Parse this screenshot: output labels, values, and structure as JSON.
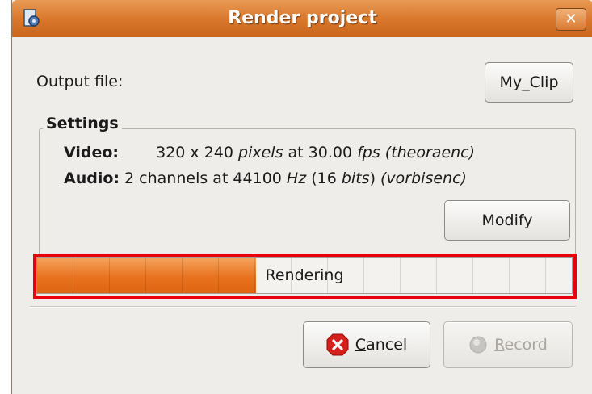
{
  "window": {
    "title": "Render project",
    "close_label": "✕",
    "app_icon": "gear-document-icon"
  },
  "output": {
    "label": "Output file:",
    "file_button_label": "My_Clip"
  },
  "settings": {
    "legend": "Settings",
    "video_label": "Video:",
    "video_value_pre": "320 x 240 ",
    "video_value_unit1": "pixels",
    "video_value_mid": " at 30.00 ",
    "video_value_unit2": "fps (theoraenc)",
    "audio_label": "Audio:",
    "audio_value_pre": "2 channels at 44100 ",
    "audio_value_unit1": "Hz",
    "audio_value_mid": " (16 ",
    "audio_value_unit2": "bits",
    "audio_value_post": ") ",
    "audio_value_codec": "(vorbisenc)",
    "modify_label": "Modify"
  },
  "progress": {
    "text": "Rendering",
    "fraction": 0.41,
    "accent_color": "#e8731f",
    "highlight_color": "#e8000b"
  },
  "buttons": {
    "cancel_prefix": "",
    "cancel_mnemonic": "C",
    "cancel_rest": "ancel",
    "cancel_icon": "cancel-icon",
    "record_mnemonic": "R",
    "record_rest": "ecord",
    "record_icon": "record-icon"
  }
}
